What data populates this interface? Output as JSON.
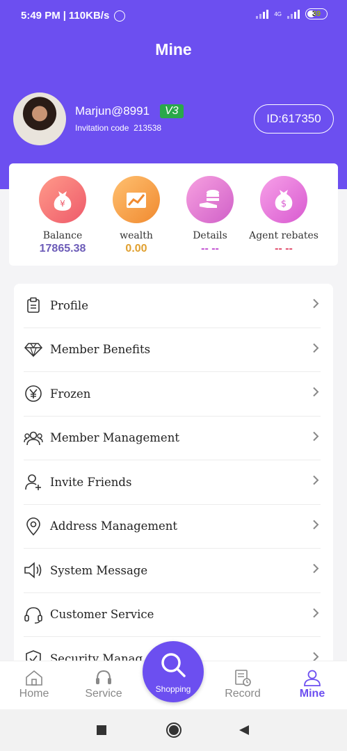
{
  "status_bar": {
    "time": "5:49 PM",
    "speed": "110KB/s",
    "battery": "39",
    "network": "4G"
  },
  "header": {
    "title": "Mine"
  },
  "profile": {
    "username": "Marjun@8991",
    "level": "V3",
    "invitation_label": "Invitation code",
    "invitation_code": "213538",
    "id": "ID:617350"
  },
  "stats": [
    {
      "label": "Balance",
      "value": "17865.38",
      "color": "#6c5cb8",
      "icon": "money-bag-icon"
    },
    {
      "label": "wealth",
      "value": "0.00",
      "color": "#e0a030",
      "icon": "growth-chart-icon"
    },
    {
      "label": "Details",
      "value": "-- --",
      "color": "#c04fd0",
      "icon": "coins-hand-icon"
    },
    {
      "label": "Agent rebates",
      "value": "-- --",
      "color": "#e04a6a",
      "icon": "dollar-bag-icon"
    }
  ],
  "menu": [
    {
      "label": "Profile",
      "icon": "clipboard-icon"
    },
    {
      "label": "Member Benefits",
      "icon": "diamond-icon"
    },
    {
      "label": "Frozen",
      "icon": "yen-circle-icon"
    },
    {
      "label": "Member Management",
      "icon": "users-icon"
    },
    {
      "label": "Invite Friends",
      "icon": "user-plus-icon"
    },
    {
      "label": "Address Management",
      "icon": "location-pin-icon"
    },
    {
      "label": "System Message",
      "icon": "speaker-icon"
    },
    {
      "label": "Customer Service",
      "icon": "headset-icon"
    },
    {
      "label": "Security Manag",
      "icon": "shield-check-icon"
    }
  ],
  "bottom_nav": {
    "home": "Home",
    "service": "Service",
    "shopping": "Shopping",
    "record": "Record",
    "mine": "Mine",
    "active": "mine",
    "accent": "#6c4ff0"
  }
}
